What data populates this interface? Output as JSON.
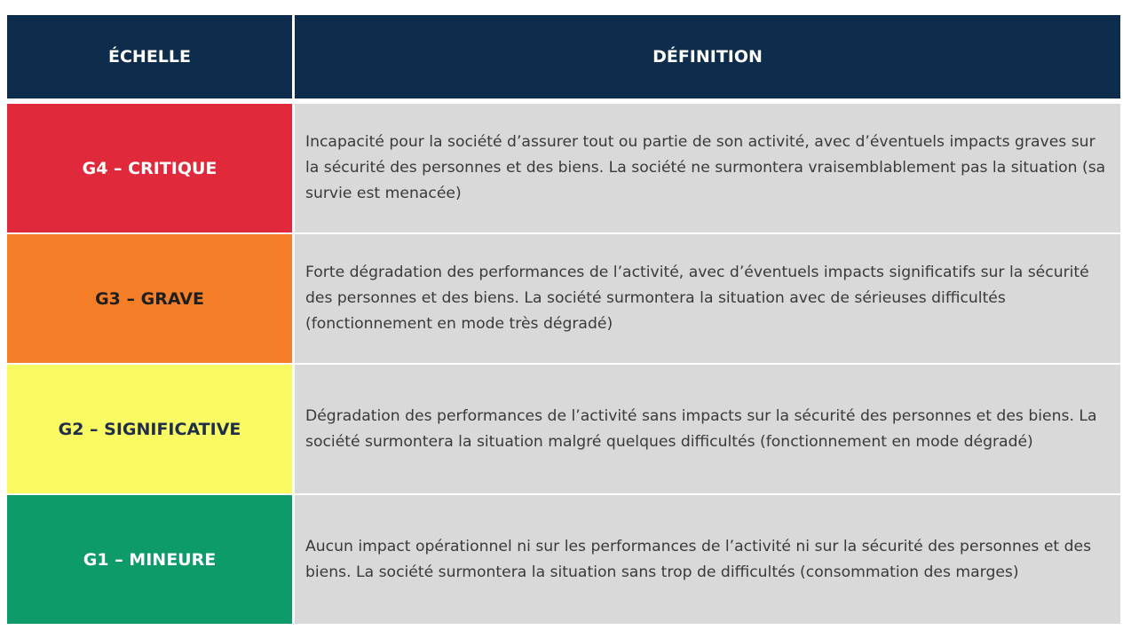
{
  "header": {
    "scale": "ÉCHELLE",
    "definition": "DÉFINITION"
  },
  "colors": {
    "header_bg": "#0e2d4d",
    "definition_bg": "#d9d9d9",
    "g4": "#e0293a",
    "g3": "#f57f29",
    "g2": "#fafa63",
    "g1": "#0d9b6a"
  },
  "rows": [
    {
      "level": "G4 – CRITIQUE",
      "definition": "Incapacité pour la société d’assurer tout ou partie de son activité, avec d’éventuels impacts graves sur la sécurité des personnes et des biens. La société ne surmontera vraisemblablement pas la situation (sa survie est menacée)"
    },
    {
      "level": "G3 – GRAVE",
      "definition": "Forte dégradation des performances de l’activité, avec d’éventuels impacts significatifs sur la sécurité des personnes et des biens. La société surmontera la situation avec de sérieuses difficultés (fonctionnement en mode très dégradé)"
    },
    {
      "level": "G2 – SIGNIFICATIVE",
      "definition": "Dégradation des performances de l’activité sans impacts sur la sécurité des personnes et des biens. La société surmontera la situation malgré quelques difficultés (fonctionnement en mode dégradé)"
    },
    {
      "level": "G1 – MINEURE",
      "definition": "Aucun impact opérationnel ni sur les performances de l’activité ni sur la sécurité des personnes et des biens. La société surmontera la situation sans trop de difficultés (consommation des marges)"
    }
  ]
}
